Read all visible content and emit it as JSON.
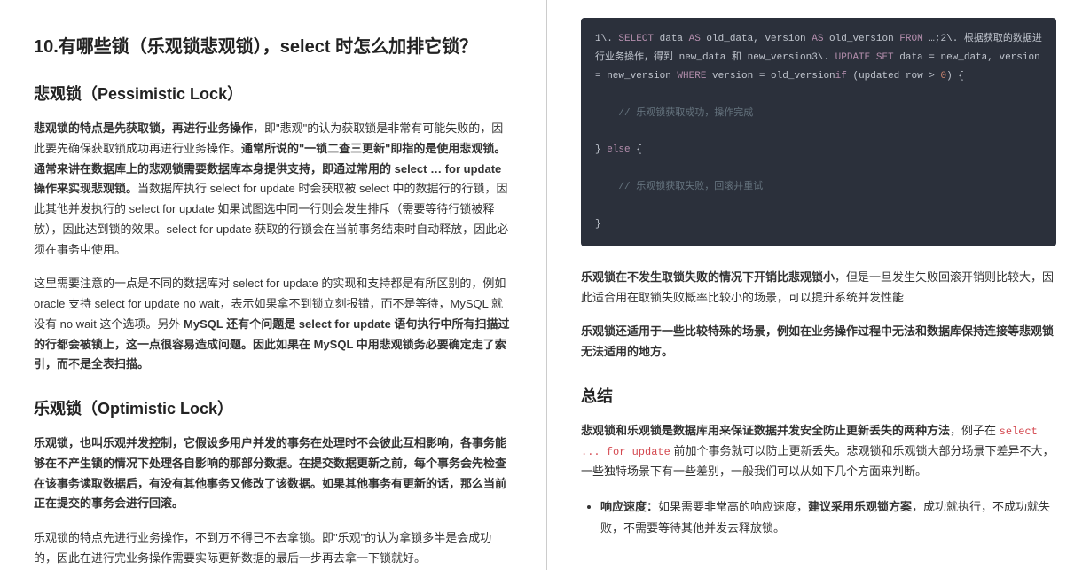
{
  "left": {
    "title": "10.有哪些锁（乐观锁悲观锁），select 时怎么加排它锁？",
    "h_pess": "悲观锁（Pessimistic Lock）",
    "pess_p1_a": "悲观锁的特点是先获取锁，再进行业务操作",
    "pess_p1_b": "，即\"悲观\"的认为获取锁是非常有可能失败的，因此要先确保获取锁成功再进行业务操作。",
    "pess_p1_c": "通常所说的\"一锁二查三更新\"即指的是使用悲观锁。通常来讲在数据库上的悲观锁需要数据库本身提供支持，即通过常用的 select … for update 操作来实现悲观锁。",
    "pess_p1_d": "当数据库执行 select for update 时会获取被 select 中的数据行的行锁，因此其他并发执行的 select for update 如果试图选中同一行则会发生排斥（需要等待行锁被释放），因此达到锁的效果。select for update 获取的行锁会在当前事务结束时自动释放，因此必须在事务中使用。",
    "pess_p2_a": "这里需要注意的一点是不同的数据库对 select for update 的实现和支持都是有所区别的，例如 oracle 支持 select for update no wait，表示如果拿不到锁立刻报错，而不是等待，MySQL 就没有 no wait 这个选项。另外 ",
    "pess_p2_b": "MySQL 还有个问题是 select for update 语句执行中所有扫描过的行都会被锁上，这一点很容易造成问题。因此如果在 MySQL 中用悲观锁务必要确定走了索引，而不是全表扫描。",
    "h_opt": "乐观锁（Optimistic Lock）",
    "opt_p1": "乐观锁，也叫乐观并发控制，它假设多用户并发的事务在处理时不会彼此互相影响，各事务能够在不产生锁的情况下处理各自影响的那部分数据。在提交数据更新之前，每个事务会先检查在该事务读取数据后，有没有其他事务又修改了该数据。如果其他事务有更新的话，那么当前正在提交的事务会进行回滚。",
    "opt_p2": "乐观锁的特点先进行业务操作，不到万不得已不去拿锁。即\"乐观\"的认为拿锁多半是会成功的，因此在进行完业务操作需要实际更新数据的最后一步再去拿一下锁就好。"
  },
  "right": {
    "code": {
      "l1_a": "1\\. ",
      "l1_sel": "SELECT",
      "l1_b": " data ",
      "l1_as1": "AS",
      "l1_c": " old_data, version ",
      "l1_as2": "AS",
      "l1_d": " old_version ",
      "l1_from": "FROM",
      "l1_e": " …;",
      "l1_2": "2\\. ",
      "l1_f": "根据获取的数据进行业务操作，得到 new_data 和 new_version",
      "l1_3": "3\\. ",
      "l1_upd": "UPDATE",
      "l1_set": " SET",
      "l1_g": " data = new_data, version = new_version ",
      "l1_where": "WHERE",
      "l1_h": " version = old_version",
      "l1_if": "if",
      "l1_i": " (updated row > ",
      "l1_zero": "0",
      "l1_j": ") {",
      "l2_cmt": "// 乐观锁获取成功，操作完成",
      "l3": "} ",
      "l3_else": "else",
      "l3_b": " {",
      "l4_cmt": "// 乐观锁获取失败，回滚并重试",
      "l5": "}"
    },
    "p1_a": "乐观锁在不发生取锁失败的情况下开销比悲观锁小",
    "p1_b": "，但是一旦发生失败回滚开销则比较大，因此适合用在取锁失败概率比较小的场景，可以提升系统并发性能",
    "p2": "乐观锁还适用于一些比较特殊的场景，例如在业务操作过程中无法和数据库保持连接等悲观锁无法适用的地方。",
    "h_summary": "总结",
    "sum_p1_a": "悲观锁和乐观锁是数据库用来保证数据并发安全防止更新丢失的两种方法",
    "sum_p1_b": "，例子在 ",
    "sum_p1_code": "select ... for update",
    "sum_p1_c": " 前加个事务就可以防止更新丢失。悲观锁和乐观锁大部分场景下差异不大，一些独特场景下有一些差别，一般我们可以从如下几个方面来判断。",
    "bullet1_a": "响应速度：",
    "bullet1_b": "如果需要非常高的响应速度，",
    "bullet1_c": "建议采用乐观锁方案",
    "bullet1_d": "，成功就执行，不成功就失败，不需要等待其他并发去释放锁。"
  }
}
